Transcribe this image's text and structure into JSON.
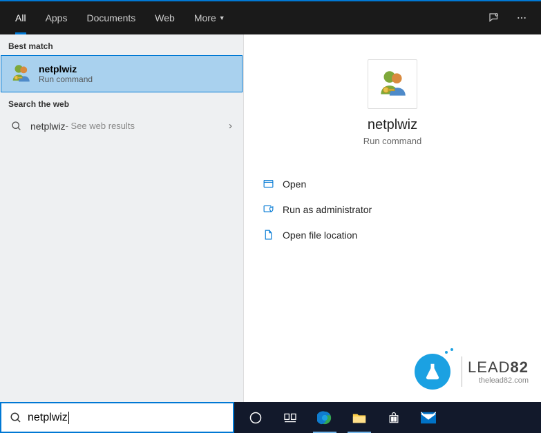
{
  "header": {
    "tabs": [
      "All",
      "Apps",
      "Documents",
      "Web",
      "More"
    ]
  },
  "left": {
    "best_match_label": "Best match",
    "best_match": {
      "title": "netplwiz",
      "subtitle": "Run command"
    },
    "search_web_label": "Search the web",
    "web_result": {
      "query": "netplwiz",
      "hint": " - See web results"
    }
  },
  "right": {
    "title": "netplwiz",
    "subtitle": "Run command",
    "actions": {
      "open": "Open",
      "run_admin": "Run as administrator",
      "open_loc": "Open file location"
    }
  },
  "watermark": {
    "brand_a": "LEAD",
    "brand_b": "82",
    "url": "thelead82.com"
  },
  "search": {
    "value": "netplwiz"
  }
}
